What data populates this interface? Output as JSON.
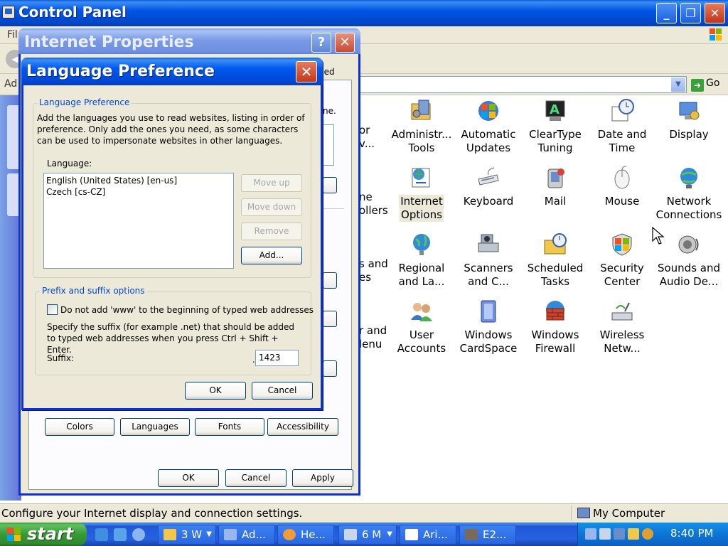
{
  "control_panel": {
    "title": "Control Panel",
    "menu_partial": "Fil",
    "address_partial": "Ad",
    "go_label": "Go",
    "status_text": "Configure your Internet display and connection settings.",
    "status_zone": "My Computer",
    "partial_items": [
      {
        "line1": "or",
        "line2": "v..."
      },
      {
        "line1": "ne",
        "line2": "ollers"
      },
      {
        "line1": "s and",
        "line2": "es"
      },
      {
        "line1": "r and",
        "line2": "lenu"
      }
    ],
    "items": [
      {
        "line1": "Administr...",
        "line2": "Tools"
      },
      {
        "line1": "Automatic",
        "line2": "Updates"
      },
      {
        "line1": "ClearType",
        "line2": "Tuning"
      },
      {
        "line1": "Date and",
        "line2": "Time"
      },
      {
        "line1": "Display",
        "line2": ""
      },
      {
        "line1": "Internet",
        "line2": "Options"
      },
      {
        "line1": "Keyboard",
        "line2": ""
      },
      {
        "line1": "Mail",
        "line2": ""
      },
      {
        "line1": "Mouse",
        "line2": ""
      },
      {
        "line1": "Network",
        "line2": "Connections"
      },
      {
        "line1": "Regional",
        "line2": "and La..."
      },
      {
        "line1": "Scanners",
        "line2": "and C..."
      },
      {
        "line1": "Scheduled",
        "line2": "Tasks"
      },
      {
        "line1": "Security",
        "line2": "Center"
      },
      {
        "line1": "Sounds and",
        "line2": "Audio De..."
      },
      {
        "line1": "User",
        "line2": "Accounts"
      },
      {
        "line1": "Windows",
        "line2": "CardSpace"
      },
      {
        "line1": "Windows",
        "line2": "Firewall"
      },
      {
        "line1": "Wireless",
        "line2": "Netw..."
      }
    ]
  },
  "internet_properties": {
    "title": "Internet Properties",
    "tab_partial": "ced",
    "text_partial": "ne.",
    "buttons": {
      "colors": "Colors",
      "languages": "Languages",
      "fonts": "Fonts",
      "accessibility": "Accessibility"
    },
    "ok": "OK",
    "cancel": "Cancel",
    "apply": "Apply"
  },
  "language_preference": {
    "title": "Language Preference",
    "group1_label": "Language Preference",
    "description": "Add the languages you use to read websites, listing in order of preference. Only add the ones you need, as some characters can be used to impersonate websites in other languages.",
    "language_label": "Language:",
    "languages": [
      "English (United States) [en-us]",
      "Czech [cs-CZ]"
    ],
    "move_up": "Move up",
    "move_down": "Move down",
    "remove": "Remove",
    "add": "Add...",
    "group2_label": "Prefix and suffix options",
    "checkbox_label": "Do not add 'www' to the beginning of typed web addresses",
    "suffix_desc": "Specify the suffix (for example .net) that should be added to typed web addresses when you press Ctrl + Shift + Enter.",
    "suffix_label": "Suffix:",
    "suffix_dot": ".",
    "suffix_value": "1423",
    "ok": "OK",
    "cancel": "Cancel"
  },
  "taskbar": {
    "start_label": "start",
    "tasks": [
      "3 W",
      "Ad...",
      "He...",
      "6 M",
      "Ari...",
      "E2..."
    ],
    "clock": "8:40 PM"
  }
}
